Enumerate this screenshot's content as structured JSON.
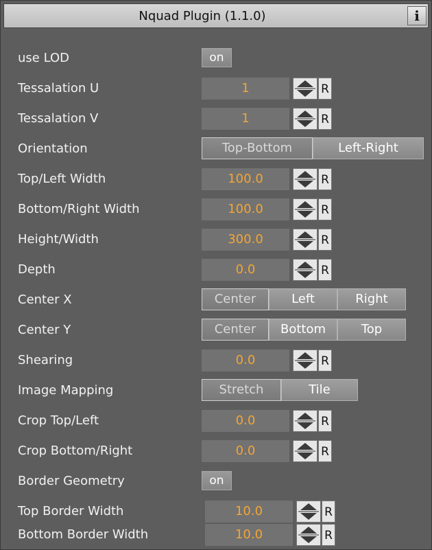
{
  "panel": {
    "title": "Nquad Plugin (1.1.0)",
    "info_label": "i"
  },
  "rows": {
    "use_lod": {
      "label": "use LOD",
      "value": "on"
    },
    "tess_u": {
      "label": "Tessalation U",
      "value": "1",
      "reset": "R"
    },
    "tess_v": {
      "label": "Tessalation V",
      "value": "1",
      "reset": "R"
    },
    "orientation": {
      "label": "Orientation",
      "options": [
        "Top-Bottom",
        "Left-Right"
      ],
      "selected": "Top-Bottom"
    },
    "top_left_width": {
      "label": "Top/Left Width",
      "value": "100.0",
      "reset": "R"
    },
    "bottom_right_width": {
      "label": "Bottom/Right Width",
      "value": "100.0",
      "reset": "R"
    },
    "height_width": {
      "label": "Height/Width",
      "value": "300.0",
      "reset": "R"
    },
    "depth": {
      "label": "Depth",
      "value": "0.0",
      "reset": "R"
    },
    "center_x": {
      "label": "Center X",
      "options": [
        "Center",
        "Left",
        "Right"
      ],
      "selected": "Center"
    },
    "center_y": {
      "label": "Center Y",
      "options": [
        "Center",
        "Bottom",
        "Top"
      ],
      "selected": "Center"
    },
    "shearing": {
      "label": "Shearing",
      "value": "0.0",
      "reset": "R"
    },
    "image_mapping": {
      "label": "Image Mapping",
      "options": [
        "Stretch",
        "Tile"
      ],
      "selected": "Stretch"
    },
    "crop_top_left": {
      "label": "Crop Top/Left",
      "value": "0.0",
      "reset": "R"
    },
    "crop_bottom_right": {
      "label": "Crop Bottom/Right",
      "value": "0.0",
      "reset": "R"
    },
    "border_geometry": {
      "label": "Border Geometry",
      "value": "on"
    },
    "top_border_width": {
      "label": "Top Border Width",
      "value": "10.0",
      "reset": "R"
    },
    "bottom_border_width": {
      "label": "Bottom Border Width",
      "value": "10.0",
      "reset": "R"
    }
  },
  "colors": {
    "panel_bg": "#5d5d5d",
    "value_text": "#f3a536",
    "label_text": "#f2f2f2"
  }
}
